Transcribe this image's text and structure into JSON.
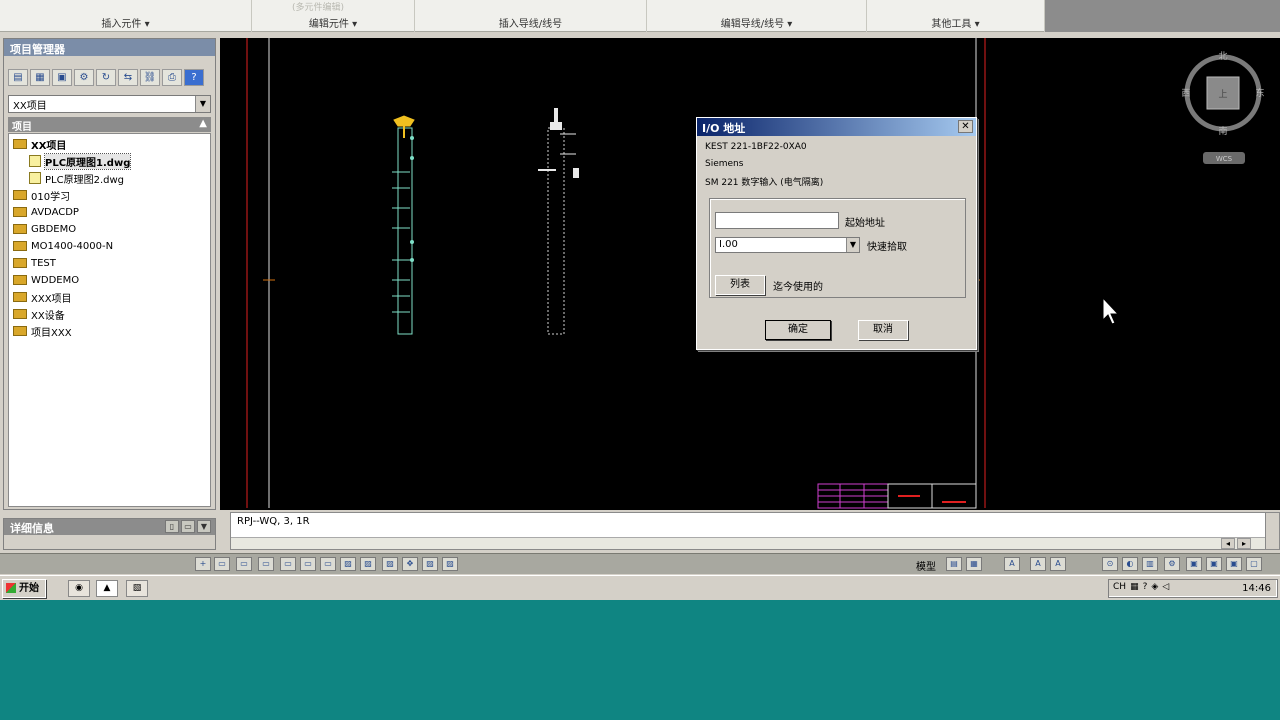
{
  "ribbon": {
    "groups": [
      {
        "label": "插入元件 ▾",
        "ghost": ""
      },
      {
        "label": "编辑元件 ▾",
        "ghost": "(多元件编辑)"
      },
      {
        "label": "插入导线/线号",
        "ghost": ""
      },
      {
        "label": "编辑导线/线号 ▾",
        "ghost": ""
      },
      {
        "label": "其他工具 ▾",
        "ghost": ""
      }
    ]
  },
  "project_manager": {
    "title": "项目管理器",
    "toolbar_icons": [
      "open-project-icon",
      "new-project-icon",
      "new-drawing-icon",
      "settings-icon",
      "refresh-icon",
      "swap-icon",
      "link-icon",
      "print-icon",
      "help-icon"
    ],
    "selected_project": "XX项目",
    "section_header": "项目",
    "tree": [
      {
        "label": "XX项目",
        "type": "folder",
        "bold": true,
        "level": 0
      },
      {
        "label": "PLC原理图1.dwg",
        "type": "dwg",
        "bold": true,
        "level": 1,
        "selected": true
      },
      {
        "label": "PLC原理图2.dwg",
        "type": "dwg",
        "bold": false,
        "level": 1
      },
      {
        "label": "010学习",
        "type": "folder",
        "bold": false,
        "level": 0
      },
      {
        "label": "AVDACDP",
        "type": "folder",
        "bold": false,
        "level": 0
      },
      {
        "label": "GBDEMO",
        "type": "folder",
        "bold": false,
        "level": 0
      },
      {
        "label": "MO1400-4000-N",
        "type": "folder",
        "bold": false,
        "level": 0
      },
      {
        "label": "TEST",
        "type": "folder",
        "bold": false,
        "level": 0
      },
      {
        "label": "WDDEMO",
        "type": "folder",
        "bold": false,
        "level": 0
      },
      {
        "label": "XXX项目",
        "type": "folder",
        "bold": false,
        "level": 0
      },
      {
        "label": "XX设备",
        "type": "folder",
        "bold": false,
        "level": 0
      },
      {
        "label": "项目XXX",
        "type": "folder",
        "bold": false,
        "level": 0
      }
    ]
  },
  "details_panel": {
    "title": "详细信息"
  },
  "viewcube": {
    "north": "北",
    "south": "南",
    "west": "西",
    "east": "东",
    "center": "上",
    "wcs": "WCS"
  },
  "dialog": {
    "title": "I/O 地址",
    "line1": "KEST 221-1BF22-0XA0",
    "line2": "Siemens",
    "line3": "SM 221 数字输入 (电气隔离)",
    "start_address_value": "",
    "start_address_label": "起始地址",
    "quick_pick_value": "I.00",
    "quick_pick_label": "快速拾取",
    "list_button": "列表",
    "list_label": "迄今使用的",
    "ok_button": "确定",
    "cancel_button": "取消"
  },
  "command_line": {
    "text": "RPJ--WQ, 3, 1R"
  },
  "statusbar": {
    "model_label": "模型"
  },
  "taskbar": {
    "start_label": "开始",
    "clock": "14:46",
    "tray_lang": "CH"
  },
  "colors": {
    "canvas": "#000000",
    "border_red": "#e02020",
    "wire_green": "#7fe0c8",
    "desktop": "#0f8582",
    "dialog_title": "#0a246a"
  }
}
